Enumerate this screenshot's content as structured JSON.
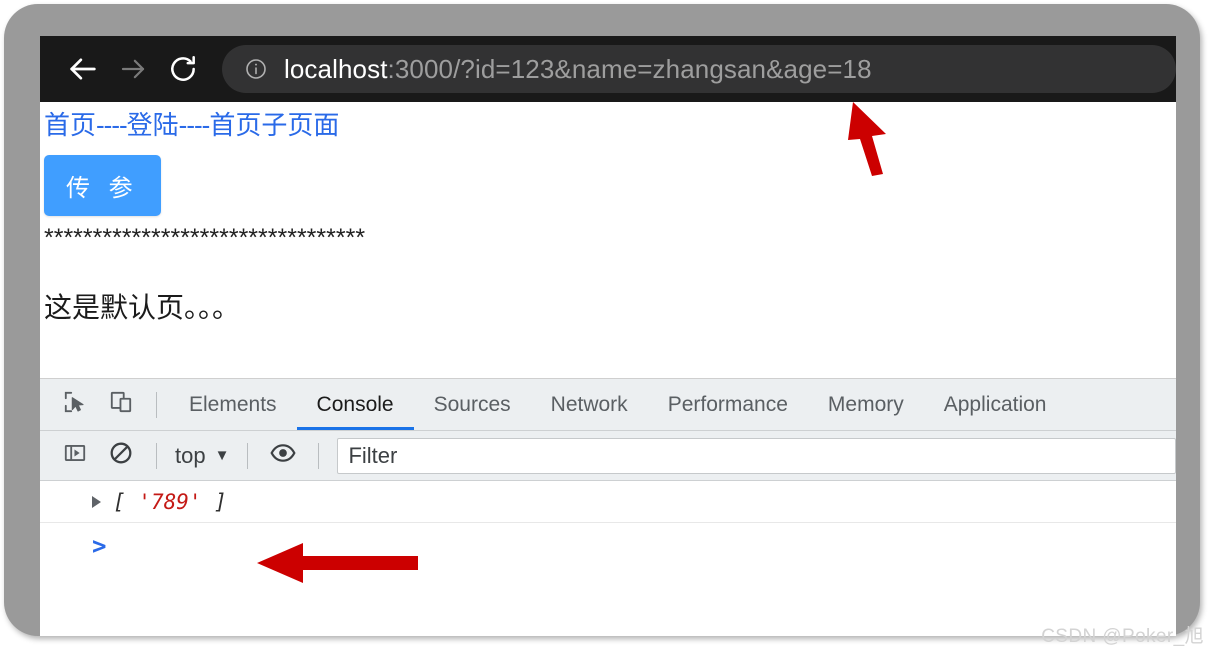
{
  "browser": {
    "back_icon": "arrow-left-icon",
    "forward_icon": "arrow-right-icon",
    "reload_icon": "reload-icon",
    "site_info_icon": "info-circle-icon",
    "url_host": "localhost",
    "url_rest": ":3000/?id=123&name=zhangsan&age=18",
    "url_full": "localhost:3000/?id=123&name=zhangsan&age=18"
  },
  "page": {
    "links": [
      {
        "label": "首页"
      },
      {
        "label": "登陆"
      },
      {
        "label": "首页子页面"
      }
    ],
    "link_separator": "----",
    "button_label": "传 参",
    "separator_line": "*********************************",
    "body_text": "这是默认页。。。"
  },
  "devtools": {
    "inspect_icon": "inspect-element-icon",
    "device_toolbar_icon": "device-toggle-icon",
    "tabs": [
      {
        "label": "Elements",
        "active": false
      },
      {
        "label": "Console",
        "active": true
      },
      {
        "label": "Sources",
        "active": false
      },
      {
        "label": "Network",
        "active": false
      },
      {
        "label": "Performance",
        "active": false
      },
      {
        "label": "Memory",
        "active": false
      },
      {
        "label": "Application",
        "active": false
      }
    ],
    "console_toolbar": {
      "sidebar_icon": "console-sidebar-icon",
      "clear_icon": "clear-console-icon",
      "context": "top",
      "context_caret": "▼",
      "eye_icon": "live-expression-eye-icon",
      "filter_placeholder": "Filter",
      "filter_value": ""
    },
    "console_output": [
      {
        "expand_icon": "disclosure-triangle-icon",
        "prefix": "[ ",
        "string_value": "'789'",
        "suffix": " ]"
      }
    ],
    "prompt_symbol": ">"
  },
  "annotations": {
    "arrow_url_name": "red-arrow-pointing-to-url",
    "arrow_console_name": "red-arrow-pointing-to-console-output",
    "arrow_color": "#cc0000"
  },
  "watermark": "CSDN @Poker_旭"
}
